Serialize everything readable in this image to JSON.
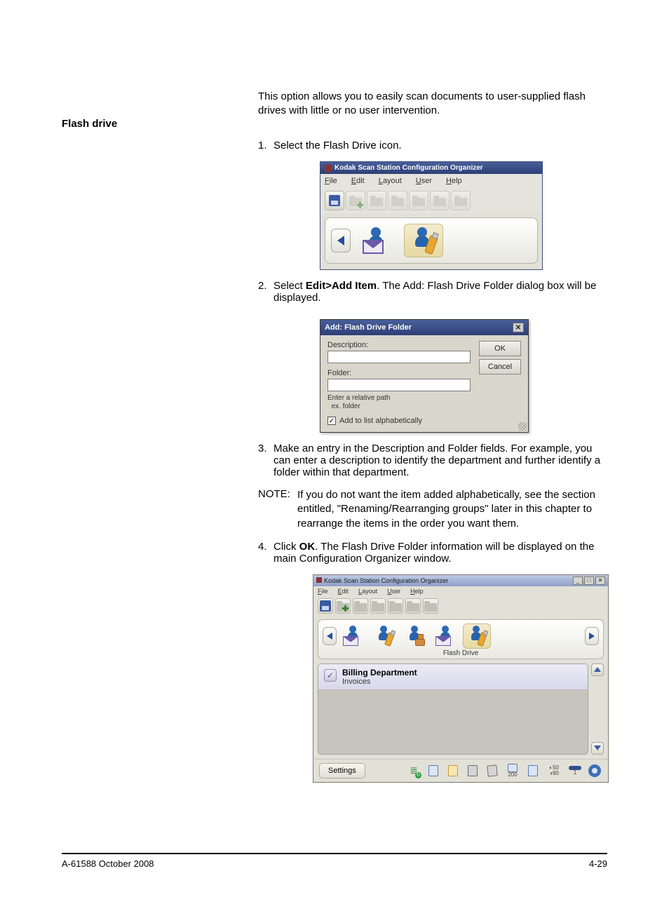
{
  "section": {
    "title": "Flash drive"
  },
  "intro": "This option allows you to easily scan documents to user-supplied flash drives with little or no user intervention.",
  "steps": [
    {
      "n": "1.",
      "t": "Select the Flash Drive icon."
    },
    {
      "n": "2.",
      "t_pre": "Select ",
      "t_bold": "Edit>Add Item",
      "t_post": ". The Add: Flash Drive Folder dialog box will be displayed."
    },
    {
      "n": "3.",
      "t": "Make an entry in the Description and Folder fields. For example, you can enter a description to identify the department and further identify a folder within that department."
    },
    {
      "n": "4.",
      "t_pre": "Click ",
      "t_bold": "OK",
      "t_post": ". The Flash Drive Folder information will be displayed on the main Configuration Organizer window."
    }
  ],
  "noteLabel": "NOTE:",
  "noteText": " If you do not want the item added alphabetically, see the section entitled, \"Renaming/Rearranging groups\" later in this chapter to rearrange the items in the order you want them.",
  "fig1": {
    "title": "Kodak Scan Station Configuration Organizer",
    "menu": [
      "File",
      "Edit",
      "Layout",
      "User",
      "Help"
    ]
  },
  "fig2": {
    "title": "Add:  Flash Drive Folder",
    "descriptionLabel": "Description:",
    "folderLabel": "Folder:",
    "hint1": "Enter a relative path",
    "hint2": "ex. folder",
    "chkLabel": "Add to list alphabetically",
    "ok": "OK",
    "cancel": "Cancel"
  },
  "fig3": {
    "title": "Kodak Scan Station Configuration Organizer",
    "menu": [
      "File",
      "Edit",
      "Layout",
      "User",
      "Help"
    ],
    "stripCaption": "Flash Drive",
    "row": {
      "title": "Billing Department",
      "sub": "Invoices"
    },
    "settings": "Settings",
    "status": {
      "dpi": "200",
      "copies": "1",
      "c": "50",
      "b": "90"
    }
  },
  "footer": {
    "left": "A-61588  October 2008",
    "right": "4-29"
  }
}
